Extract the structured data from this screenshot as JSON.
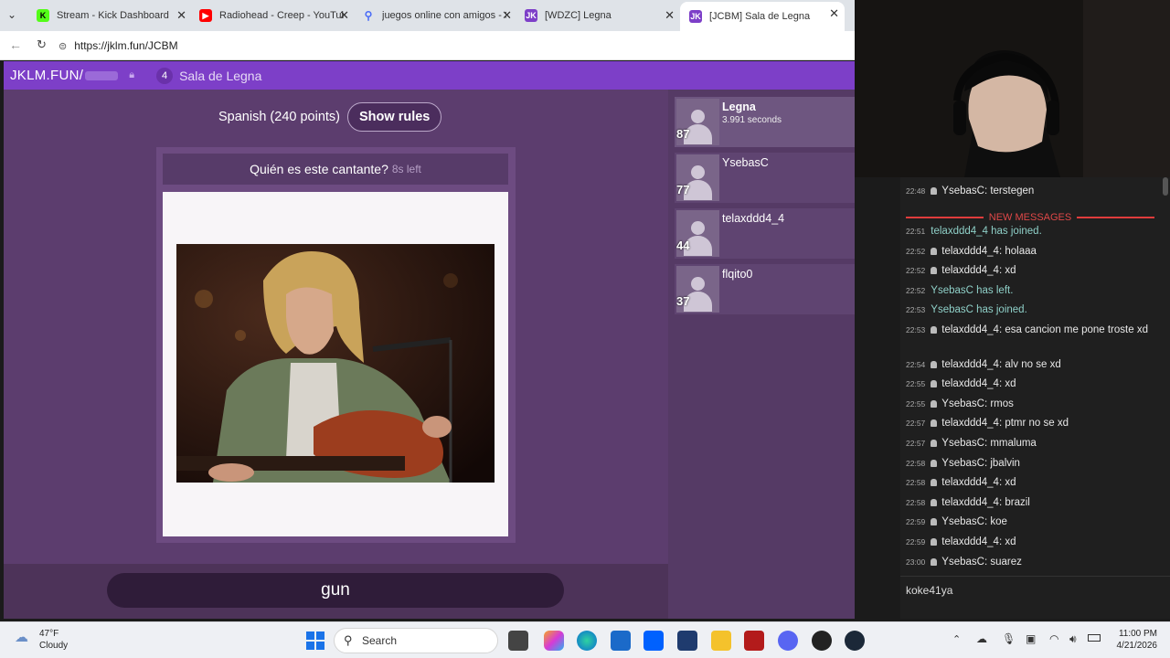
{
  "browser": {
    "tabs": [
      {
        "label": "Stream - Kick Dashboard",
        "icon": "kick-icon",
        "color": "#53fc18"
      },
      {
        "label": "Radiohead - Creep - YouTube",
        "icon": "youtube-icon",
        "color": "#ff0000"
      },
      {
        "label": "juegos online con amigos - S",
        "icon": "search-icon",
        "color": "#4a6cf7"
      },
      {
        "label": "[WDZC] Legna",
        "icon": "jklm-icon",
        "color": "#7d3fc8"
      },
      {
        "label": "[JCBM] Sala de Legna",
        "icon": "jklm-icon",
        "color": "#7d3fc8"
      }
    ],
    "url": "https://jklm.fun/JCBM"
  },
  "game": {
    "logo": "JKLM.FUN/",
    "room_number": "4",
    "room_name": "Sala de Legna",
    "rules_text": "Spanish (240 points)",
    "show_rules_label": "Show rules",
    "question": "Quién es este cantante?",
    "timer": "8s left",
    "answer_input": "gun",
    "accent_color": "#7d3fc8"
  },
  "players": [
    {
      "name": "Legna",
      "sub": "3.991 seconds",
      "score": "87"
    },
    {
      "name": "YsebasC",
      "sub": "",
      "score": "77"
    },
    {
      "name": "telaxddd4_4",
      "sub": "",
      "score": "44"
    },
    {
      "name": "flqito0",
      "sub": "",
      "score": "37"
    }
  ],
  "chat": {
    "new_messages_label": "NEW MESSAGES",
    "messages": [
      {
        "time": "22:48",
        "user": "YsebasC",
        "text": "terstegen",
        "system": false
      },
      {
        "time": "22:51",
        "user": "",
        "text": "telaxddd4_4 has joined.",
        "system": true
      },
      {
        "time": "22:52",
        "user": "telaxddd4_4",
        "text": "holaaa",
        "system": false
      },
      {
        "time": "22:52",
        "user": "telaxddd4_4",
        "text": "xd",
        "system": false
      },
      {
        "time": "22:52",
        "user": "",
        "text": "YsebasC has left.",
        "system": true
      },
      {
        "time": "22:53",
        "user": "",
        "text": "YsebasC has joined.",
        "system": true
      },
      {
        "time": "22:53",
        "user": "telaxddd4_4",
        "text": "esa cancion me pone troste xd",
        "system": false
      },
      {
        "time": "22:54",
        "user": "telaxddd4_4",
        "text": "alv no se xd",
        "system": false
      },
      {
        "time": "22:55",
        "user": "telaxddd4_4",
        "text": "xd",
        "system": false
      },
      {
        "time": "22:55",
        "user": "YsebasC",
        "text": "rmos",
        "system": false
      },
      {
        "time": "22:57",
        "user": "telaxddd4_4",
        "text": "ptmr no se xd",
        "system": false
      },
      {
        "time": "22:57",
        "user": "YsebasC",
        "text": "mmaluma",
        "system": false
      },
      {
        "time": "22:58",
        "user": "YsebasC",
        "text": "jbalvin",
        "system": false
      },
      {
        "time": "22:58",
        "user": "telaxddd4_4",
        "text": "xd",
        "system": false
      },
      {
        "time": "22:58",
        "user": "telaxddd4_4",
        "text": "brazil",
        "system": false
      },
      {
        "time": "22:59",
        "user": "YsebasC",
        "text": "koe",
        "system": false
      },
      {
        "time": "22:59",
        "user": "telaxddd4_4",
        "text": "xd",
        "system": false
      },
      {
        "time": "23:00",
        "user": "YsebasC",
        "text": "suarez",
        "system": false
      }
    ],
    "input_value": "koke41ya"
  },
  "taskbar": {
    "weather_temp": "47°F",
    "weather_desc": "Cloudy",
    "search_label": "Search",
    "time": "11:00 PM",
    "date": "4/21/2026"
  }
}
